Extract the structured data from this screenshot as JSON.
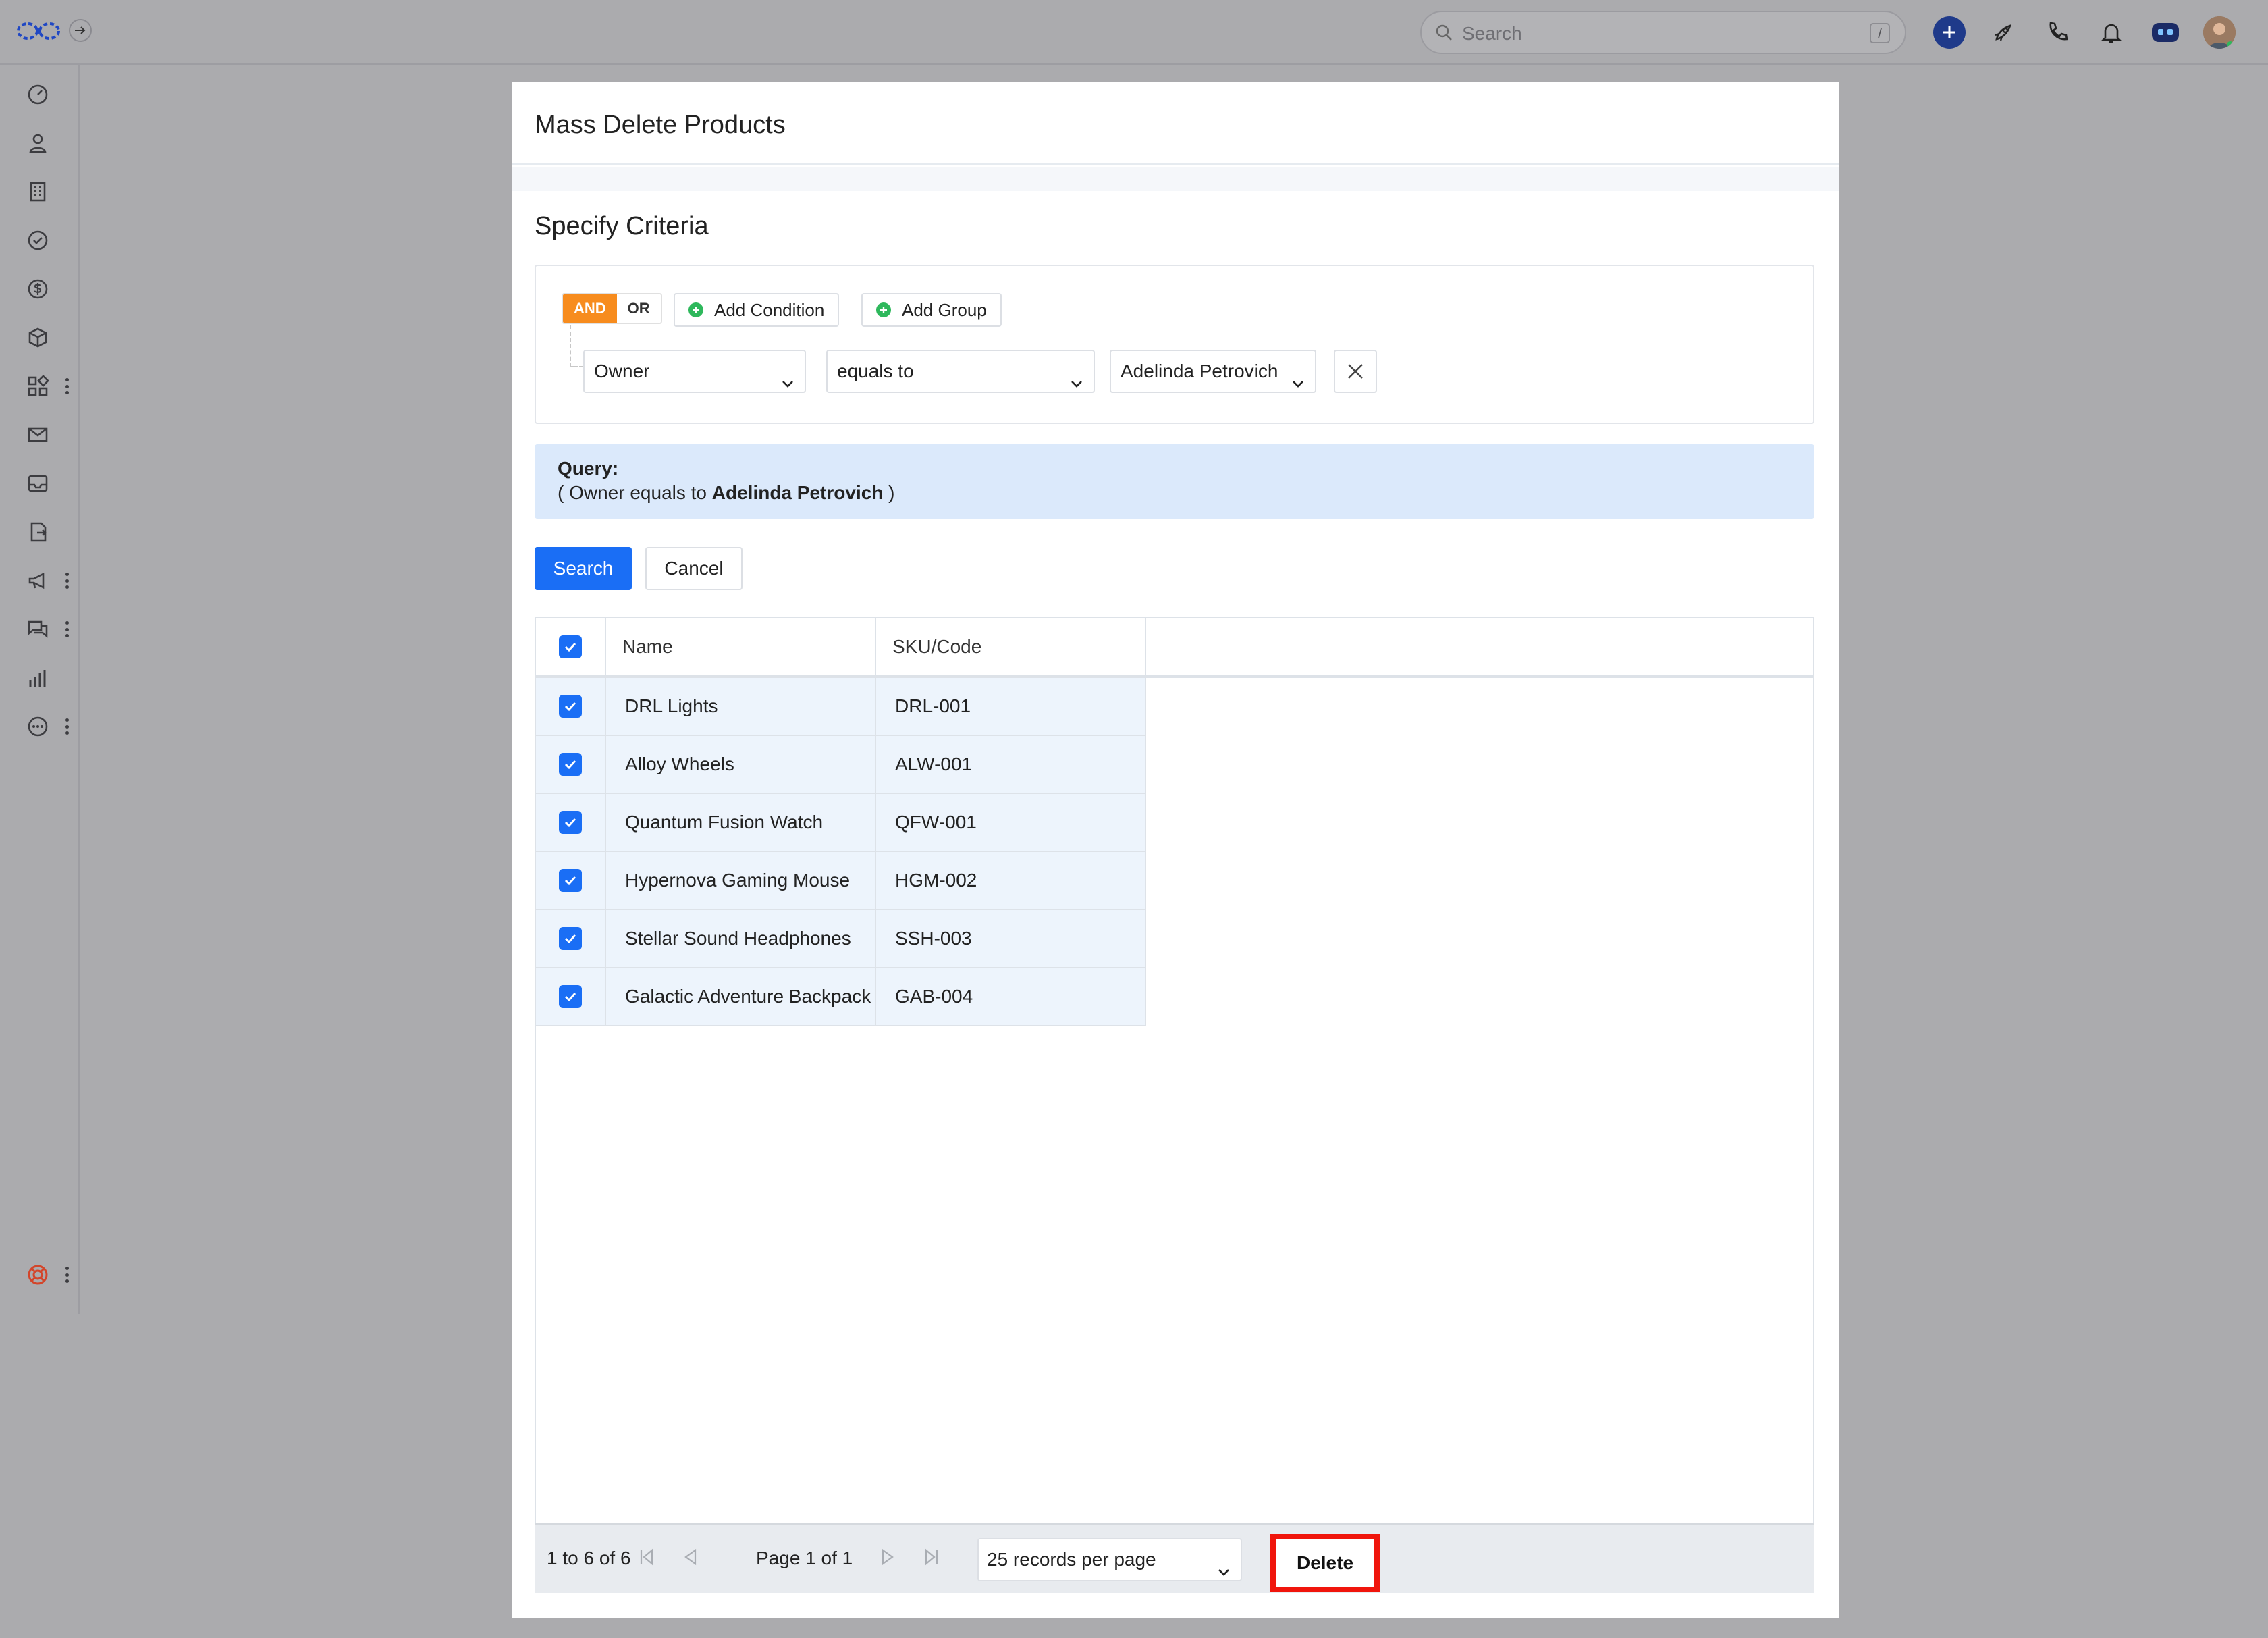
{
  "topbar": {
    "search_placeholder": "Search",
    "search_shortcut": "/"
  },
  "sidebar": {
    "items": [
      {
        "icon": "dashboard-icon"
      },
      {
        "icon": "contacts-icon"
      },
      {
        "icon": "accounts-icon"
      },
      {
        "icon": "tasks-icon"
      },
      {
        "icon": "deals-icon"
      },
      {
        "icon": "products-icon"
      },
      {
        "icon": "apps-icon",
        "more": true
      },
      {
        "icon": "mail-icon"
      },
      {
        "icon": "inbox-icon"
      },
      {
        "icon": "documents-icon"
      },
      {
        "icon": "campaigns-icon",
        "more": true
      },
      {
        "icon": "chat-icon",
        "more": true
      },
      {
        "icon": "reports-icon"
      },
      {
        "icon": "more-icon",
        "more": true
      }
    ],
    "help_icon": "lifebuoy-icon"
  },
  "modal": {
    "title": "Mass Delete Products",
    "section_title": "Specify Criteria",
    "criteria": {
      "and_label": "AND",
      "or_label": "OR",
      "add_condition_label": "Add Condition",
      "add_group_label": "Add Group",
      "field": "Owner",
      "operator": "equals to",
      "value": "Adelinda Petrovich"
    },
    "query": {
      "label": "Query:",
      "open": "( Owner equals to ",
      "value": "Adelinda Petrovich",
      "close": " )"
    },
    "search_button": "Search",
    "cancel_button": "Cancel",
    "grid": {
      "columns": [
        "Name",
        "SKU/Code"
      ],
      "rows": [
        {
          "name": "DRL Lights",
          "sku": "DRL-001",
          "checked": true
        },
        {
          "name": "Alloy Wheels",
          "sku": "ALW-001",
          "checked": true
        },
        {
          "name": "Quantum Fusion Watch",
          "sku": "QFW-001",
          "checked": true
        },
        {
          "name": "Hypernova Gaming Mouse",
          "sku": "HGM-002",
          "checked": true
        },
        {
          "name": "Stellar Sound Headphones",
          "sku": "SSH-003",
          "checked": true
        },
        {
          "name": "Galactic Adventure Backpack",
          "sku": "GAB-004",
          "checked": true
        }
      ]
    },
    "footer": {
      "count": "1 to 6 of 6",
      "page_info": "Page 1 of 1",
      "page_size": "25 records per page",
      "delete_button": "Delete"
    }
  },
  "colors": {
    "accent": "#1a6ef5",
    "and_active": "#f78c1e",
    "highlight": "#f0150c",
    "query_bg": "#dbe9fb"
  }
}
